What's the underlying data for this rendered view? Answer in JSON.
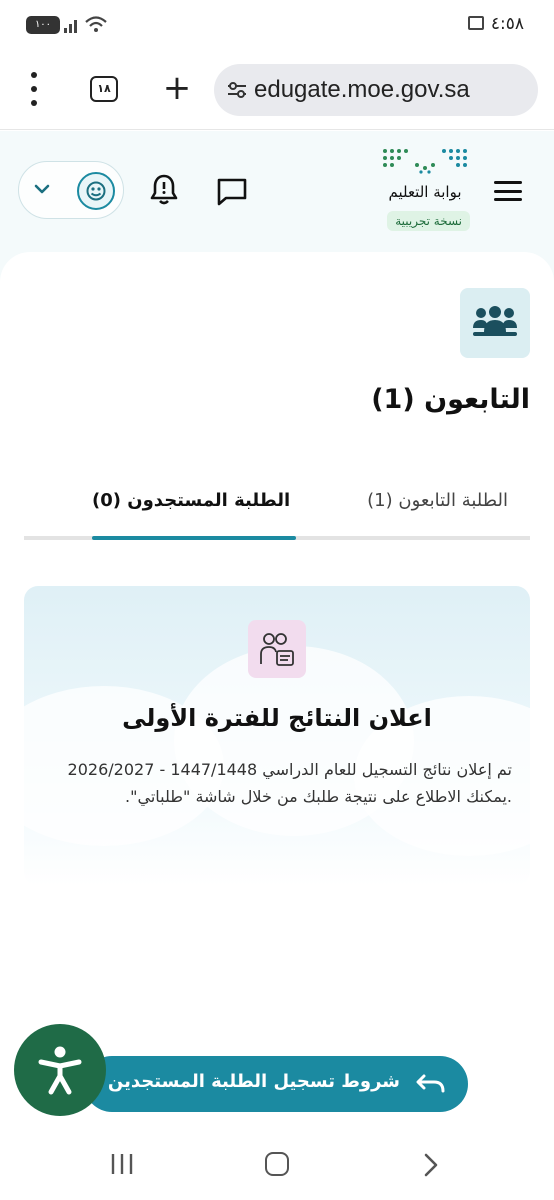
{
  "status_bar": {
    "time": "٤:٥٨",
    "battery": "١٠٠",
    "sim_icon": "sim-card-icon",
    "signal_icon": "signal-icon",
    "wifi_icon": "wifi-icon"
  },
  "browser": {
    "url": "edugate.moe.gov.sa",
    "tab_count": "١٨",
    "menu_icon": "more-vert-icon",
    "new_tab_icon": "plus-icon",
    "site_settings_icon": "tune-icon"
  },
  "header": {
    "portal_name": "بوابة التعليم",
    "beta_label": "نسخة تجريبية",
    "menu_icon": "hamburger-icon",
    "chat_icon": "chat-icon",
    "notification_icon": "bell-icon",
    "profile_icon": "avatar-icon",
    "dropdown_icon": "chevron-down-icon"
  },
  "page": {
    "title": "التابعون (1)",
    "icon": "group-icon"
  },
  "tabs": [
    {
      "label": "الطلبة التابعون (1)",
      "active": false
    },
    {
      "label": "الطلبة المستجدون (0)",
      "active": true
    }
  ],
  "notice": {
    "icon": "student-card-icon",
    "title": "اعلان النتائج للفترة الأولى",
    "body": "تم إعلان نتائج التسجيل للعام الدراسي 1447/1448 - 2026/2027 .يمكنك الاطلاع على نتيجة طلبك من خلال شاشة \"طلباتي\"."
  },
  "actions": {
    "conditions_label": "شروط تسجيل الطلبة المستجدين",
    "conditions_icon": "undo-icon",
    "accessibility_icon": "accessibility-icon"
  },
  "colors": {
    "primary": "#1b8aa1",
    "accessibility": "#1f6b47",
    "beta_bg": "#dff3e5",
    "header_bg": "#f4fafb"
  }
}
